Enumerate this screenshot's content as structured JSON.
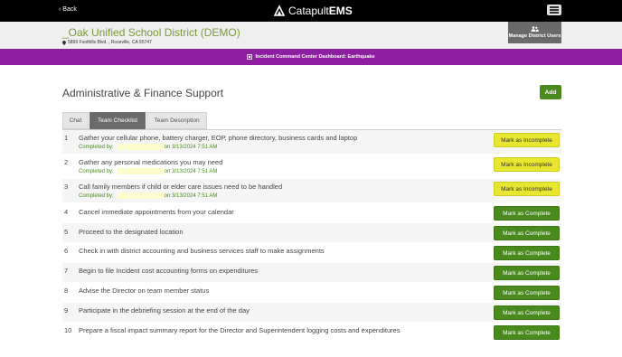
{
  "topbar": {
    "back_label": "‹ Back",
    "brand_name": "Catapult",
    "brand_suffix": "EMS"
  },
  "header": {
    "district_name": "_Oak Unified School District (DEMO)",
    "address": "5899 Foothills Blvd. , Roseville, CA 95747",
    "manage_users_label": "Manage District Users"
  },
  "banner": {
    "text": "Incident Command Center Dashboard: Earthquake"
  },
  "main": {
    "title": "Administrative & Finance Support",
    "add_label": "Add",
    "tabs": [
      {
        "label": "Chat",
        "active": false
      },
      {
        "label": "Team Checklist",
        "active": true
      },
      {
        "label": "Team Description",
        "active": false
      }
    ]
  },
  "checklist": [
    {
      "num": "1",
      "task": "Gather your cellular phone, battery charger, EOP, phone directory, business cards and laptop",
      "completed_label": "Completed by:",
      "completed_on": "on 3/13/2024 7:51 AM",
      "button": "Mark as Incomplete",
      "status": "done"
    },
    {
      "num": "2",
      "task": "Gather any personal medications you may need",
      "completed_label": "Completed by:",
      "completed_on": "on 3/13/2024 7:51 AM",
      "button": "Mark as Incomplete",
      "status": "done"
    },
    {
      "num": "3",
      "task": "Call family members if child or elder care issues need to be handled",
      "completed_label": "Completed by:",
      "completed_on": "on 3/13/2024 7:51 AM",
      "button": "Mark as Incomplete",
      "status": "done"
    },
    {
      "num": "4",
      "task": "Cancel immediate appointments from your calendar",
      "button": "Mark as Complete",
      "status": "todo"
    },
    {
      "num": "5",
      "task": "Proceed to the designated location",
      "button": "Mark as Complete",
      "status": "todo"
    },
    {
      "num": "6",
      "task": "Check in with district accounting and business services staff to make assignments",
      "button": "Mark as Complete",
      "status": "todo"
    },
    {
      "num": "7",
      "task": "Begin to file Incident cost accounting forms on expenditures",
      "button": "Mark as Complete",
      "status": "todo"
    },
    {
      "num": "8",
      "task": "Advise the Director on team member status",
      "button": "Mark as Complete",
      "status": "todo"
    },
    {
      "num": "9",
      "task": "Participate in the debriefing session at the end of the day",
      "button": "Mark as Complete",
      "status": "todo"
    },
    {
      "num": "10",
      "task": "Prepare a fiscal impact summary report for the Director and Superintendent logging costs and expenditures",
      "button": "Mark as Complete",
      "status": "todo"
    }
  ],
  "colors": {
    "topbar": "#000000",
    "banner": "#8e1fa0",
    "district_text": "#7a9a3a",
    "complete_button": "#4a8a1c",
    "incomplete_button": "#e8e62e"
  }
}
